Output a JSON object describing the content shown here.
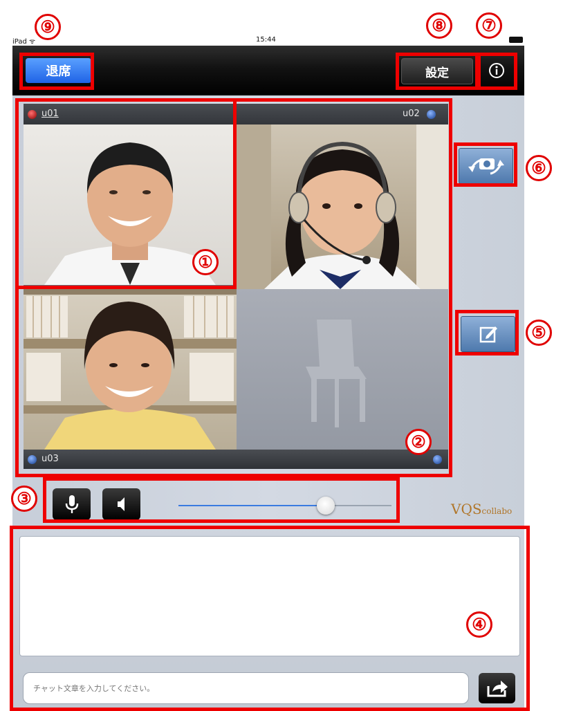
{
  "status_bar": {
    "carrier": "iPad ᯤ",
    "time": "15:44"
  },
  "toolbar": {
    "leave_label": "退席",
    "settings_label": "設定"
  },
  "participants": {
    "tile1": {
      "name": "u01"
    },
    "tile2": {
      "name": "u02"
    },
    "tile3": {
      "name": "u03"
    }
  },
  "brand": {
    "logo_main": "VQS",
    "logo_sub": "collabo"
  },
  "chat": {
    "input_placeholder": "チャット文章を入力してください。"
  },
  "markers": {
    "m1": "①",
    "m2": "②",
    "m3": "③",
    "m4": "④",
    "m5": "⑤",
    "m6": "⑥",
    "m7": "⑦",
    "m8": "⑧",
    "m9": "⑨"
  },
  "audio": {
    "volume_level": 0.69
  },
  "icons": {
    "info": "info-icon",
    "camera_switch": "camera-switch-icon",
    "edit": "edit-icon",
    "microphone": "microphone-icon",
    "speaker": "speaker-icon",
    "send": "send-icon",
    "empty_chair": "chair-icon"
  },
  "colors": {
    "annotation": "#ee0000",
    "leave_button": "#1f63e6",
    "accent_slider": "#3a7be0",
    "logo": "#b0762a"
  }
}
